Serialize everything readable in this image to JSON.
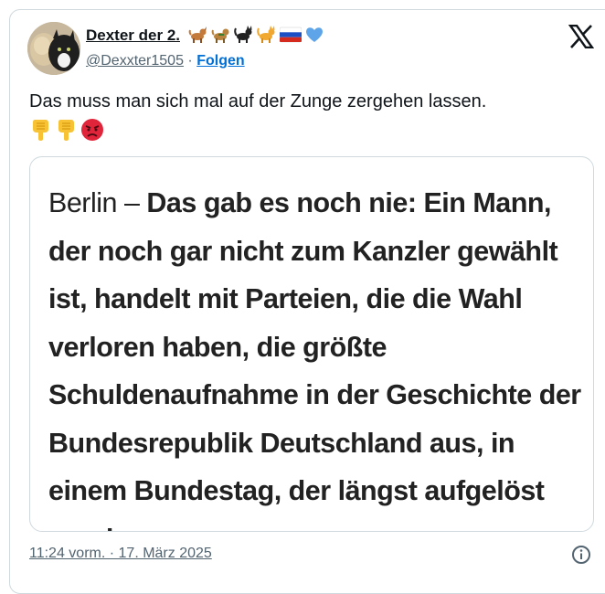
{
  "author": {
    "display_name": "Dexter der 2.",
    "name_emojis": [
      "dog-icon",
      "dog-icon",
      "black-cat-icon",
      "cat-icon",
      "russian-flag-icon",
      "blue-heart-icon"
    ],
    "handle": "@Dexxter1505",
    "separator": "·",
    "follow_label": "Folgen"
  },
  "tweet": {
    "text": "Das muss man sich mal auf der Zunge zergehen lassen.",
    "emojis": [
      "pointing-down-icon",
      "pointing-down-icon",
      "angry-face-icon"
    ]
  },
  "media": {
    "place": "Berlin –",
    "body": "Das gab es noch nie: Ein Mann, der noch gar nicht zum Kanzler gewählt ist, handelt mit Parteien, die die Wahl verloren haben, die größte Schuldenaufnahme in der Geschichte der Bundesrepublik Deutschland aus, in einem Bundestag, der längst aufgelöst wurde."
  },
  "footer": {
    "timestamp": "11:24 vorm. · 17. März 2025"
  },
  "colors": {
    "link_blue": "#006fd6",
    "muted": "#536471",
    "border": "#cfd9de"
  }
}
